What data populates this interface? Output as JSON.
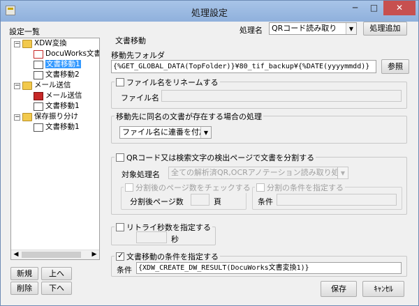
{
  "window": {
    "title": "処理設定"
  },
  "header": {
    "process_name_label": "処理名",
    "process_name_value": "QRコード読み取り",
    "add_process_button": "処理追加"
  },
  "left": {
    "title": "設定一覧",
    "tree": [
      {
        "label": "XDW変換",
        "icon": "folder-icon"
      },
      {
        "label": "DocuWorks文書変換",
        "icon": "pdf-icon"
      },
      {
        "label": "文書移動1",
        "icon": "move-document-icon",
        "selected": true
      },
      {
        "label": "文書移動2",
        "icon": "move-document-icon"
      },
      {
        "label": "メール送信",
        "icon": "folder-icon"
      },
      {
        "label": "メール送信",
        "icon": "mail-icon"
      },
      {
        "label": "文書移動1",
        "icon": "move-document-icon"
      },
      {
        "label": "保存振り分け",
        "icon": "folder-icon"
      },
      {
        "label": "文書移動1",
        "icon": "move-document-icon"
      }
    ],
    "buttons": {
      "new": "新規",
      "up": "上へ",
      "delete": "削除",
      "down": "下へ"
    }
  },
  "main": {
    "section_title": "文書移動",
    "dest_folder_label": "移動先フォルダ",
    "dest_folder_value": "{%GET_GLOBAL_DATA(TopFolder)}¥80_tif_backup¥{%DATE(yyyymmdd)}",
    "browse_button": "参照",
    "rename": {
      "label": "ファイル名をリネームする",
      "checked": false,
      "filename_label": "ファイル名",
      "filename_value": ""
    },
    "conflict": {
      "legend": "移動先に同名の文書が存在する場合の処理",
      "value": "ファイル名に連番を付加する"
    },
    "split": {
      "label": "QRコード又は検索文字の検出ページで文書を分割する",
      "checked": false,
      "target_label": "対象処理名",
      "target_value": "全ての解析済QR,OCRアノテーション読み取り処理",
      "page_check_label": "分割後のページ数をチェックする",
      "page_count_label": "分割後ページ数",
      "page_count_value": "",
      "page_unit": "頁",
      "cond_check_label": "分割の条件を指定する",
      "cond_label": "条件",
      "cond_value": ""
    },
    "retry": {
      "label": "リトライ秒数を指定する",
      "checked": false,
      "value": "",
      "unit": "秒"
    },
    "move_cond": {
      "label": "文書移動の条件を指定する",
      "checked": true,
      "cond_label": "条件",
      "cond_value": "{XDW_CREATE_DW_RESULT(DocuWorks文書変換1)}"
    },
    "save_button": "保存",
    "cancel_button": "ｷｬﾝｾﾙ"
  },
  "colors": {
    "selection": "#3399ff",
    "close_button": "#c7504f",
    "title_bar": "#a8c4e8"
  }
}
